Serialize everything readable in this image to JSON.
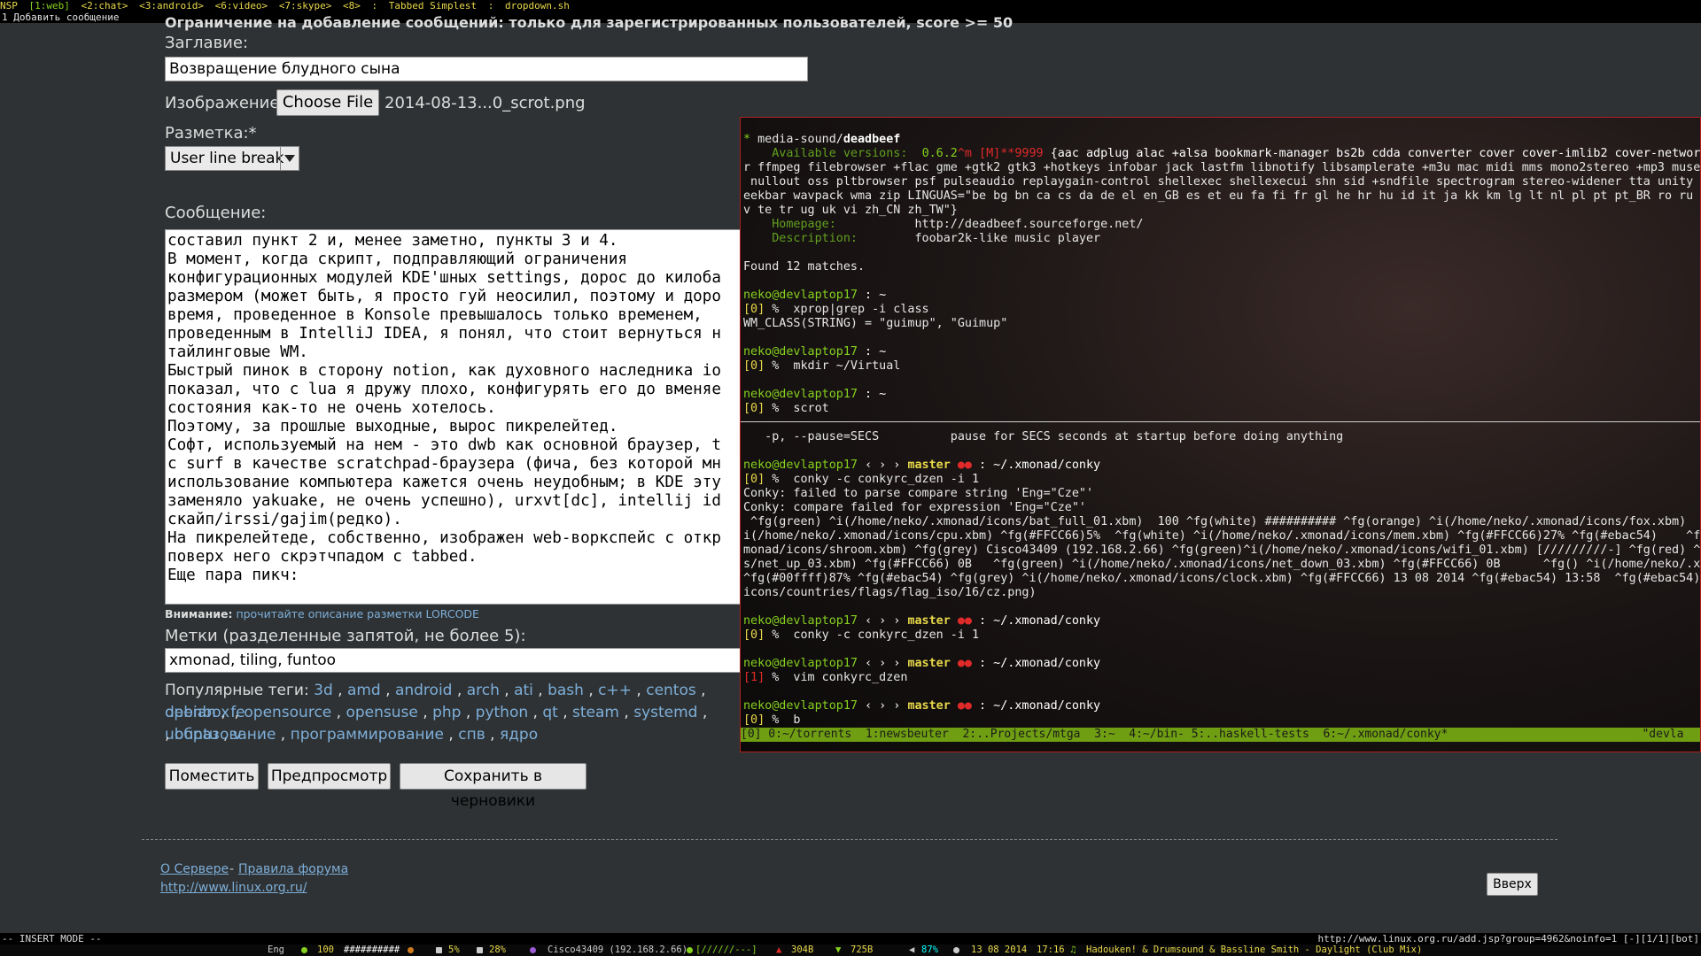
{
  "topbar": {
    "workspaces": [
      "NSP",
      "[1:web]",
      "<2:chat>",
      "<3:android>",
      "<6:video>",
      "<7:skype>",
      "<8>"
    ],
    "layout": "Tabbed Simplest",
    "window": "dropdown.sh",
    "sep": ":"
  },
  "tabbar": {
    "tab": "1 Добавить сообщение"
  },
  "form": {
    "cut_heading": "Ограничение на добавление сообщений: только для зарегистрированных пользователей, score >= 50",
    "title_label": "Заглавие:",
    "title_value": "Возвращение блудного сына",
    "image_label": "Изображение:",
    "choose_file": "Choose File",
    "file_name": "2014-08-13...0_scrot.png",
    "markup_label": "Разметка:*",
    "markup_value": "User line break",
    "message_label": "Сообщение:",
    "message_lines": [
      "составил пункт 2 и, менее заметно, пункты 3 и 4.",
      "В момент, когда скрипт, подправляющий ограничения",
      "конфигурационных модулей KDE'шных settings, дорос до килоба",
      "размером (может быть, я просто гуй неосилил, поэтому и доро",
      "время, проведенное в Konsole превышалось только временем,",
      "проведенным в IntelliJ IDEA, я понял, что стоит вернуться н",
      "тайлинговые WM.",
      "Быстрый пинок в сторону notion, как духовного наследника io",
      "показал, что с lua я дружу плохо, конфигурять его до вменяе",
      "состояния как-то не очень хотелось.",
      "Поэтому, за прошлые выходные, вырос пикрелейтед.",
      "Софт, используемый на нем - это dwb как основной браузер, t",
      "с surf в качестве scratchpad-браузера (фича, без которой мн",
      "использование компьютера кажется очень неудобным; в KDE эту",
      "заменяло yakuake, не очень успешно), urxvt[dc], intellij id",
      "скайп/irssi/gajim(редко).",
      "На пикрелейтеде, собственно, изображен web-воркспейс с откр",
      "поверх него скрэтчпадом с tabbed.",
      "Еще пара пикч:"
    ],
    "notice_label": "Внимание:",
    "notice_link": "прочитайте описание разметки LORCODE",
    "tags_label": "Метки (разделенные запятой, не более 5):",
    "tags_value": "xmonad, tiling, funtoo",
    "popular_label": "Популярные теги:",
    "popular_row1": [
      "3d",
      "amd",
      "android",
      "arch",
      "ati",
      "bash",
      "c++",
      "centos",
      "debian",
      "fe"
    ],
    "popular_row2": [
      "openbox",
      "opensource",
      "opensuse",
      "php",
      "python",
      "qt",
      "steam",
      "systemd",
      "ubuntu",
      "v"
    ],
    "popular_row3": [
      "образование",
      "программирование",
      "спв",
      "ядро"
    ],
    "buttons": {
      "post": "Поместить",
      "preview": "Предпросмотр",
      "draft": "Сохранить в черновики"
    }
  },
  "footer": {
    "about": "О Сервере",
    "dash": "-",
    "rules": "Правила форума",
    "url": "http://www.linux.org.ru/",
    "top_button": "Вверх"
  },
  "terminal": {
    "pkg_star": "*",
    "pkg_cat": "media-sound/",
    "pkg_name": "deadbeef",
    "avail_label": "Available versions:",
    "avail_version": "0.6.2",
    "avail_mask": "^m [M]**9999",
    "avail_flags": "{aac adplug alac +alsa bookmark-manager bs2b cdda converter cover cover-imlib2 cover-network cue curl dts",
    "flags_2": "r ffmpeg filebrowser +flac gme +gtk2 gtk3 +hotkeys infobar jack lastfm libnotify libsamplerate +m3u mac midi mms mono2stereo +mp3 musepack",
    "flags_3": " nullout oss pltbrowser psf pulseaudio replaygain-control shellexec shellexecui shn sid +sndfile spectrogram stereo-widener tta unity vfs-",
    "flags_4": "eekbar wavpack wma zip LINGUAS=\"be bg bn ca cs da de el en_GB es et eu fa fi fr gl he hr hu id it ja kk km lg lt nl pl pt pt_BR ro ru si sk",
    "flags_5": "v te tr ug uk vi zh_CN zh_TW\"}",
    "homepage_label": "Homepage:",
    "homepage_value": "http://deadbeef.sourceforge.net/",
    "desc_label": "Description:",
    "desc_value": "foobar2k-like music player",
    "found": "Found 12 matches.",
    "prompt_user": "neko@devlaptop17",
    "home_path": " : ~",
    "xmonad_path": " : ~/.xmonad/conky",
    "branch": "master",
    "dots": "●●",
    "arrows": "‹ › ›",
    "cmd1_code": "[0]",
    "cmd1": " %  xprop|grep -i class",
    "cmd1_out": "WM_CLASS(STRING) = \"guimup\", \"Guimup\"",
    "cmd2_code": "[0]",
    "cmd2": " %  mkdir ~/Virtual",
    "cmd3_code": "[0]",
    "cmd3": " %  scrot",
    "pause_line": "   -p, --pause=SECS          pause for SECS seconds at startup before doing anything",
    "cmd4_code": "[0]",
    "cmd4": " %  conky -c conkyrc_dzen -i 1",
    "conky_err1": "Conky: failed to parse compare string 'Eng=\"Cze\"'",
    "conky_err2": "Conky: compare failed for expression 'Eng=\"Cze\"'",
    "dzen_1": " ^fg(green) ^i(/home/neko/.xmonad/icons/bat_full_01.xbm)  100 ^fg(white) ########## ^fg(orange) ^i(/home/neko/.xmonad/icons/fox.xbm)  ^fg(#",
    "dzen_2": "i(/home/neko/.xmonad/icons/cpu.xbm) ^fg(#FFCC66)5%  ^fg(white) ^i(/home/neko/.xmonad/icons/mem.xbm) ^fg(#FFCC66)27% ^fg(#ebac54)    ^fg(",
    "dzen_3": "monad/icons/shroom.xbm) ^fg(grey) Cisco43409 (192.168.2.66) ^fg(green)^i(/home/neko/.xmonad/icons/wifi_01.xbm) [/////////-] ^fg(red) ^i(",
    "dzen_4": "s/net_up_03.xbm) ^fg(#FFCC66) 0B   ^fg(green) ^i(/home/neko/.xmonad/icons/net_down_03.xbm) ^fg(#FFCC66) 0B      ^fg() ^i(/home/neko/.xmo",
    "dzen_5": "^fg(#00ffff)87% ^fg(#ebac54) ^fg(grey) ^i(/home/neko/.xmonad/icons/clock.xbm) ^fg(#FFCC66) 13 08 2014 ^fg(#ebac54) 13:58  ^fg(#ebac54) ^",
    "dzen_6": "icons/countries/flags/flag_iso/16/cz.png)",
    "cmd5_code": "[0]",
    "cmd5": " %  conky -c conkyrc_dzen -i 1",
    "cmd6_code": "[1]",
    "cmd6": " %  vim conkyrc_dzen",
    "cmd7_code": "[0]",
    "cmd7": " %  b",
    "tmux_bar": "[0] 0:~/torrents  1:newsbeuter  2:..Projects/mtga  3:~  4:~/bin- 5:..haskell-tests  6:~/.xmonad/conky*                            \"devla"
  },
  "modebar": {
    "mode": "-- INSERT MODE --",
    "url": "http://www.linux.org.ru/add.jsp?group=4962&noinfo=1 [-][1/1][bot]"
  },
  "statusbar": {
    "lang": "Eng",
    "battery": "100",
    "battery_bar": "##########",
    "cpu": "5%",
    "mem": "28%",
    "wifi": "Cisco43409 (192.168.2.66)",
    "wifi_bar": "[//////---]",
    "up": "304B",
    "down": "725B",
    "volume": "87%",
    "date": "13 08 2014",
    "time": "17:16",
    "track": "Hadouken! & Drumsound & Bassline Smith - Daylight (Club Mix)"
  },
  "colors": {
    "accent_link": "#7eaed8",
    "terminal_green": "#86d11f",
    "terminal_yellow": "#e8d84a",
    "terminal_red": "#e02a2a",
    "tmux_bar": "#6f9e12",
    "terminal_border": "#b02020"
  }
}
